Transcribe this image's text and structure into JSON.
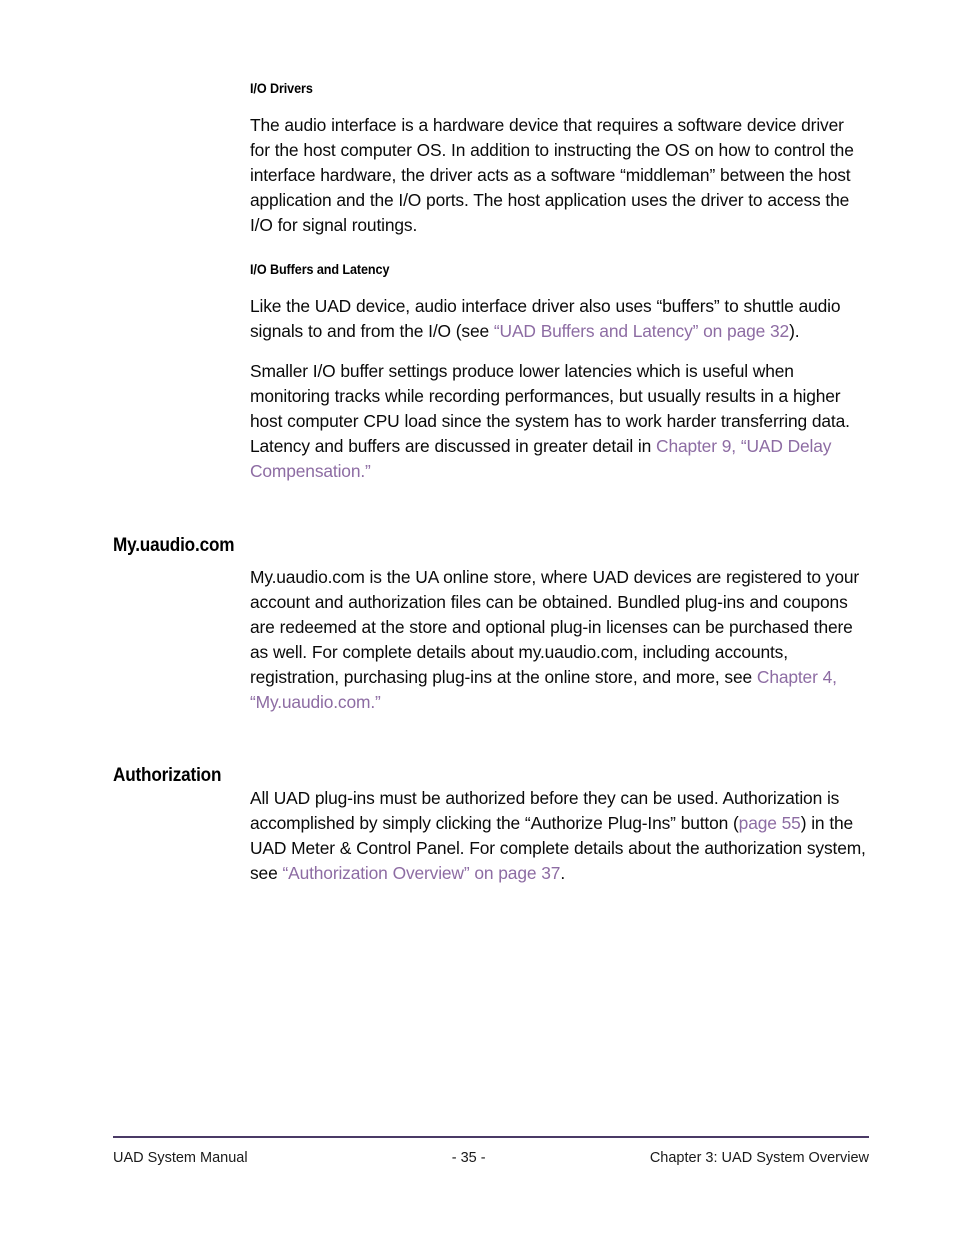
{
  "document": {
    "title": "UAD System Manual",
    "page_number": "- 35 -",
    "chapter": "Chapter 3: UAD System Overview",
    "link_color": "#8d6ca3",
    "rule_color": "#4a3a66"
  },
  "sections": {
    "io_drivers": {
      "heading": "I/O Drivers",
      "paragraph": "The audio interface is a hardware device that requires a software device driver for the host computer OS. In addition to instructing the OS on how to control the interface hardware, the driver acts as a software “middleman” between the host application and the I/O ports. The host application uses the driver to access the I/O for signal routings."
    },
    "io_buffers": {
      "heading": "I/O Buffers and Latency",
      "paragraph_1_pre": "Like the UAD device, audio interface driver also uses “buffers” to shuttle audio signals to and from the I/O (see ",
      "paragraph_1_link": "“UAD Buffers and Latency” on page 32",
      "paragraph_1_post": ").",
      "paragraph_2_pre": "Smaller I/O buffer settings produce lower latencies which is useful when monitoring tracks while recording performances, but usually results in a higher host computer CPU load since the system has to work harder transferring data. Latency and buffers are discussed in greater detail in ",
      "paragraph_2_link": "Chapter 9, “UAD Delay Compensation.”",
      "paragraph_2_post": ""
    },
    "my_uaudio": {
      "heading": "My.uaudio.com",
      "paragraph_pre": "My.uaudio.com is the UA online store, where UAD devices are registered to your account and authorization files can be obtained. Bundled plug-ins and coupons are redeemed at the store and optional plug-in licenses can be purchased there as well. For complete details about my.uaudio.com, including accounts, registration, purchasing plug-ins at the online store, and more, see ",
      "paragraph_link": "Chapter 4, “My.uaudio.com.”",
      "paragraph_post": ""
    },
    "authorization": {
      "heading": "Authorization",
      "paragraph_pre": "All UAD plug-ins must be authorized before they can be used. Authorization is accomplished by simply clicking the “Authorize Plug-Ins” button (",
      "paragraph_link_1": "page 55",
      "paragraph_mid": ") in the UAD Meter & Control Panel. For complete details about the authorization system, see ",
      "paragraph_link_2": "“Authorization Overview” on page 37",
      "paragraph_post": "."
    }
  }
}
